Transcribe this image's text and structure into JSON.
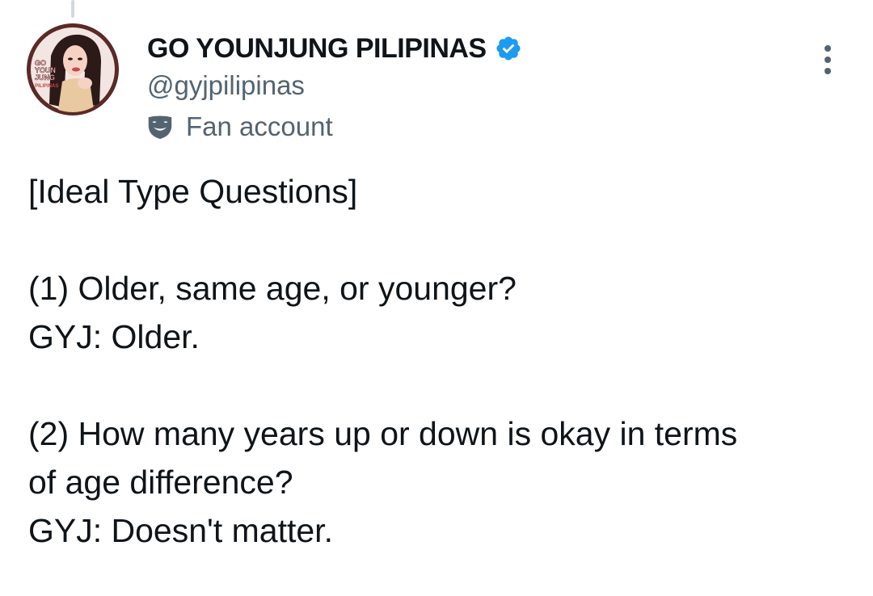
{
  "tweet": {
    "author": {
      "display_name": "GO YOUNJUNG PILIPINAS",
      "handle": "@gyjpilipinas",
      "verified": true,
      "label": "Fan account",
      "label_icon": "theater-mask-icon",
      "avatar_icon": "profile-photo",
      "avatar_text": "GO YOUN JUNG PILIPINAS"
    },
    "more_icon": "more-vertical-icon",
    "text_lines": [
      "[Ideal Type Questions]",
      "",
      "(1) Older, same age, or younger?",
      "GYJ: Older.",
      "",
      "(2) How many years up or down is okay in terms",
      "of age difference?",
      "GYJ: Doesn't matter."
    ]
  },
  "colors": {
    "text_primary": "#0f1419",
    "text_secondary": "#536471",
    "verified_blue": "#1d9bf0",
    "thread_line": "#cfd9de"
  }
}
